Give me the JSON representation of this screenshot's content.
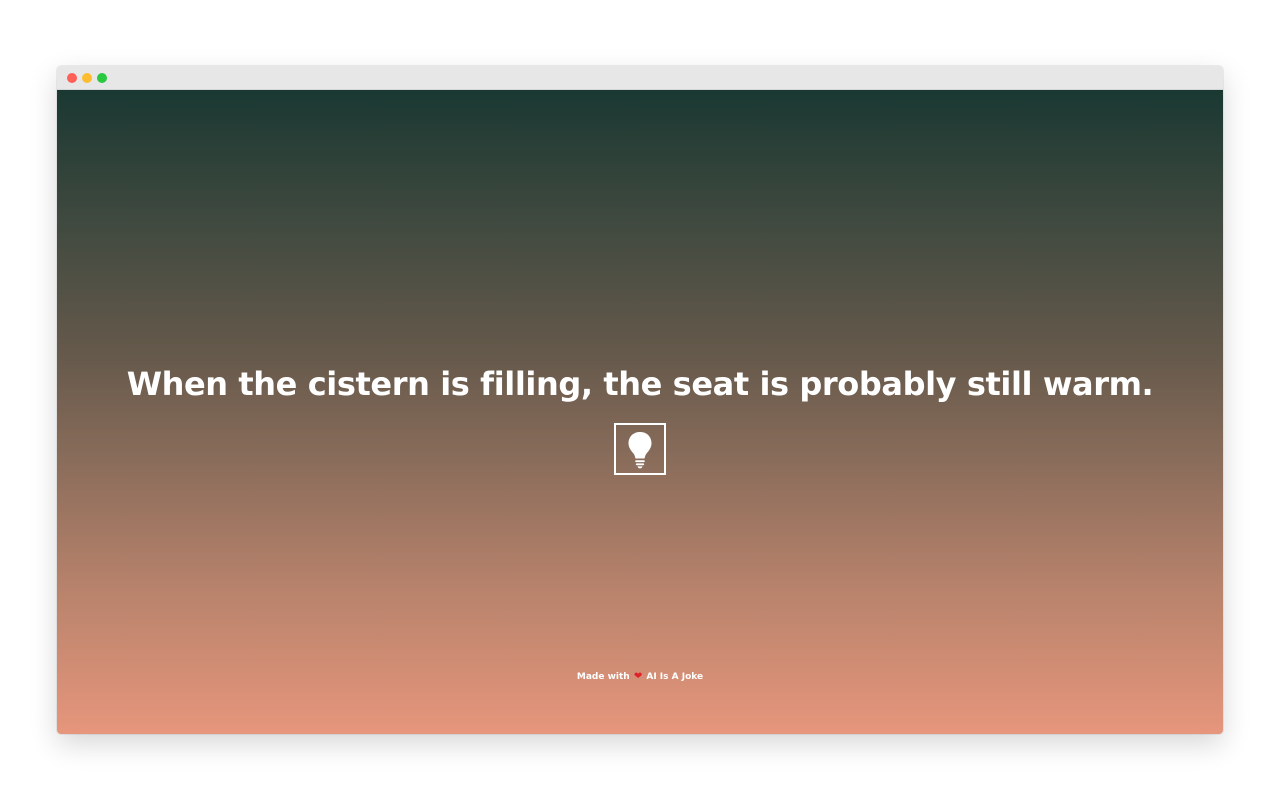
{
  "window": {
    "controls": [
      "close",
      "minimize",
      "maximize"
    ]
  },
  "joke": {
    "text": "When the cistern is filling, the seat is probably still warm."
  },
  "idea_button": {
    "icon": "lightbulb-icon"
  },
  "footer": {
    "made_with": "Made with",
    "heart": "❤",
    "brand": "AI Is A Joke"
  },
  "colors": {
    "gradient_top": "#1a3832",
    "gradient_bottom": "#e6967c",
    "text": "#ffffff",
    "heart": "#e0202a"
  }
}
